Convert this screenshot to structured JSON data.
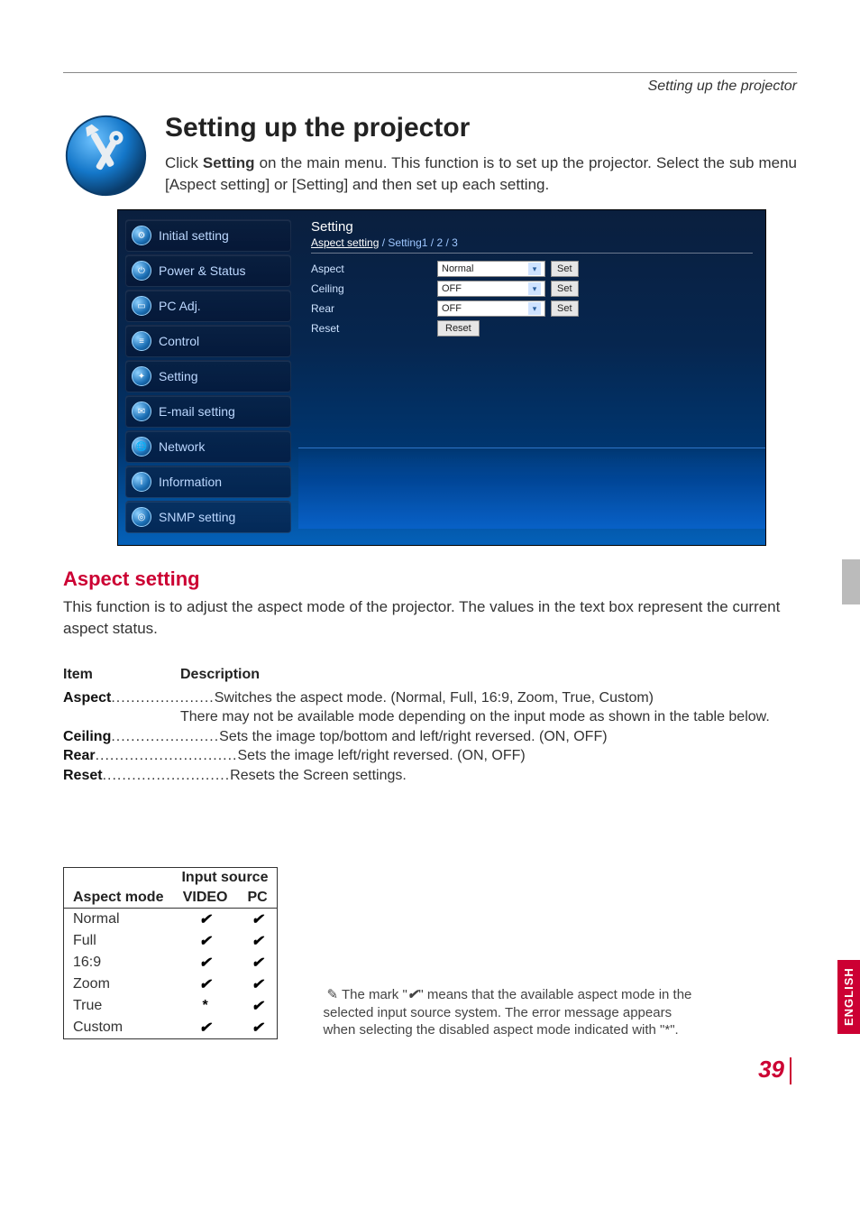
{
  "header": {
    "breadcrumb": "Setting up the projector"
  },
  "title": "Setting up the projector",
  "intro_pre": "Click ",
  "intro_bold": "Setting",
  "intro_post": " on the main menu. This function is to set up the projector. Select the sub menu [Aspect setting] or [Setting] and then set up each setting.",
  "sidebar": {
    "items": [
      {
        "label": "Initial setting"
      },
      {
        "label": "Power & Status"
      },
      {
        "label": "PC Adj."
      },
      {
        "label": "Control"
      },
      {
        "label": "Setting"
      },
      {
        "label": "E-mail setting"
      },
      {
        "label": "Network"
      },
      {
        "label": "Information"
      },
      {
        "label": "SNMP setting"
      }
    ]
  },
  "panel": {
    "title": "Setting",
    "tabs": [
      "Aspect setting",
      "Setting1",
      "2",
      "3"
    ],
    "active_tab": "Aspect setting",
    "rows": [
      {
        "label": "Aspect",
        "value": "Normal",
        "button": "Set"
      },
      {
        "label": "Ceiling",
        "value": "OFF",
        "button": "Set"
      },
      {
        "label": "Rear",
        "value": "OFF",
        "button": "Set"
      }
    ],
    "reset_label": "Reset",
    "reset_button": "Reset"
  },
  "section": {
    "heading": "Aspect setting",
    "body": "This function is to adjust the aspect mode of the projector.  The values in the text box represent the current aspect status."
  },
  "defs": {
    "head_item": "Item",
    "head_desc": "Description",
    "items": [
      {
        "name": "Aspect",
        "desc": "Switches the aspect mode. (Normal, Full, 16:9, Zoom, True,  Custom) There may not be available mode depending on the input mode as shown in the table below."
      },
      {
        "name": "Ceiling",
        "desc": "Sets the image top/bottom and left/right reversed. (ON, OFF)"
      },
      {
        "name": "Rear",
        "desc": "Sets the image left/right reversed. (ON, OFF)"
      },
      {
        "name": "Reset",
        "desc": "Resets the Screen settings."
      }
    ]
  },
  "amode_table": {
    "header_top": "Input source",
    "header_mode": "Aspect mode",
    "header_video": "VIDEO",
    "header_pc": "PC",
    "rows": [
      {
        "mode": "Normal",
        "video": "✔",
        "pc": "✔"
      },
      {
        "mode": "Full",
        "video": "✔",
        "pc": "✔"
      },
      {
        "mode": "16:9",
        "video": "✔",
        "pc": "✔"
      },
      {
        "mode": "Zoom",
        "video": "✔",
        "pc": "✔"
      },
      {
        "mode": "True",
        "video": "*",
        "pc": "✔"
      },
      {
        "mode": "Custom",
        "video": "✔",
        "pc": "✔"
      }
    ]
  },
  "note": {
    "pre": "✎ The mark \"",
    "mark": "✔",
    "post": "\" means that the available aspect mode in the selected input source system. The error message appears when selecting the disabled aspect mode indicated with \"*\"."
  },
  "side_tab": "ENGLISH",
  "page_number": "39",
  "colors": {
    "accent": "#cc0033"
  }
}
